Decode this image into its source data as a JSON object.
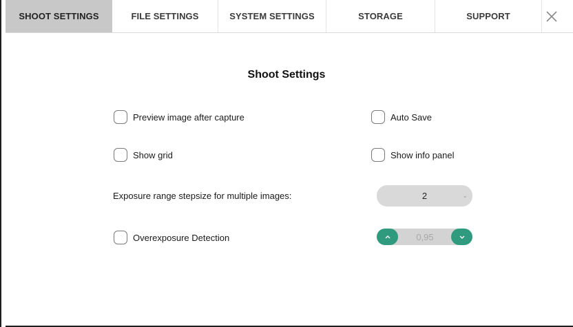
{
  "tabs": [
    {
      "label": "SHOOT SETTINGS",
      "active": true
    },
    {
      "label": "FILE SETTINGS",
      "active": false
    },
    {
      "label": "SYSTEM SETTINGS",
      "active": false
    },
    {
      "label": "STORAGE",
      "active": false
    },
    {
      "label": "SUPPORT",
      "active": false
    }
  ],
  "close_icon": "close-icon",
  "page": {
    "title": "Shoot Settings"
  },
  "options": {
    "preview_after_capture": {
      "label": "Preview image after capture",
      "checked": false
    },
    "auto_save": {
      "label": "Auto Save",
      "checked": false
    },
    "show_grid": {
      "label": "Show grid",
      "checked": false
    },
    "show_info_panel": {
      "label": "Show info panel",
      "checked": false
    },
    "overexposure_detection": {
      "label": "Overexposure Detection",
      "checked": false
    }
  },
  "exposure": {
    "label": "Exposure range stepsize for multiple images:",
    "value": "2"
  },
  "overexposure_threshold": {
    "value": "0,95"
  },
  "colors": {
    "active_tab_bg": "#c8c8c8",
    "accent_green": "#2f9a7d",
    "select_bg": "#d9d9d9"
  }
}
